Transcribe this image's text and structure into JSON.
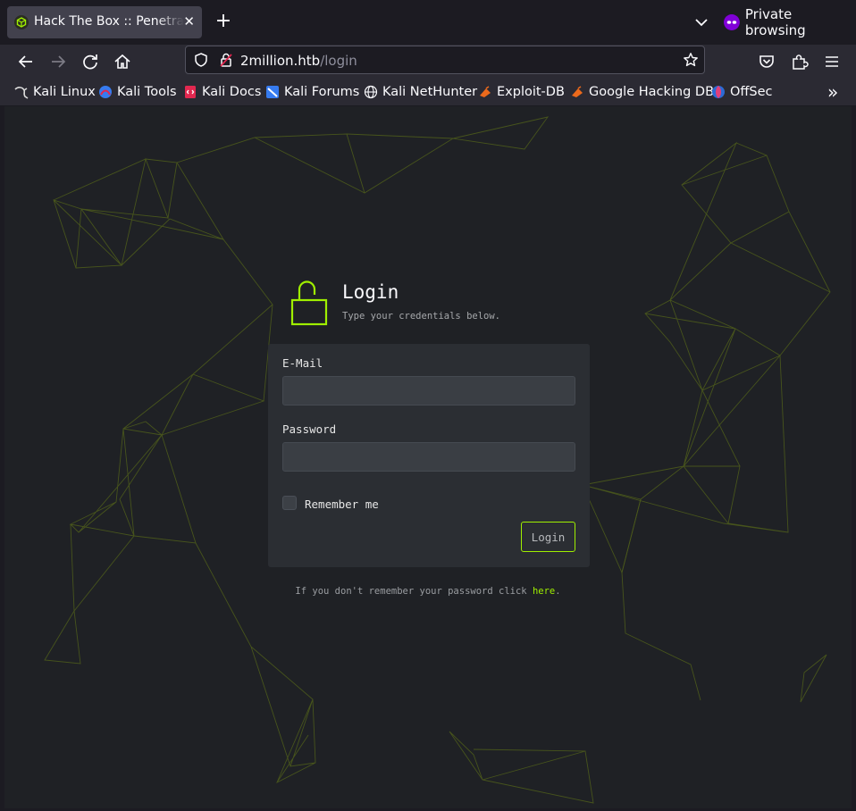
{
  "browser": {
    "tab_title": "Hack The Box :: Penetration Testing Labs",
    "tab_close": "✕",
    "new_tab": "+",
    "private_label": "Private browsing",
    "url_host": "2million.htb",
    "url_path": "/login",
    "bookmarks": [
      {
        "label": "Kali Linux",
        "icon": "kali-dragon-icon"
      },
      {
        "label": "Kali Tools",
        "icon": "kali-tools-icon"
      },
      {
        "label": "Kali Docs",
        "icon": "kali-docs-icon"
      },
      {
        "label": "Kali Forums",
        "icon": "kali-forums-icon"
      },
      {
        "label": "Kali NetHunter",
        "icon": "globe-icon"
      },
      {
        "label": "Exploit-DB",
        "icon": "exploit-db-icon"
      },
      {
        "label": "Google Hacking DB",
        "icon": "ghdb-icon"
      },
      {
        "label": "OffSec",
        "icon": "offsec-icon"
      }
    ],
    "overflow": "»"
  },
  "login": {
    "title": "Login",
    "subtitle": "Type your credentials below.",
    "email_label": "E-Mail",
    "email_value": "",
    "password_label": "Password",
    "password_value": "",
    "remember_label": "Remember me",
    "remember_checked": false,
    "button_label": "Login",
    "forgot_text": "If you don't remember your password click ",
    "forgot_link": "here",
    "forgot_end": "."
  },
  "colors": {
    "accent": "#9fef00",
    "page_bg": "#1f2125",
    "card_bg": "#2b2e33",
    "chrome_bg": "#2b2a33",
    "private_purple": "#8000d7"
  }
}
